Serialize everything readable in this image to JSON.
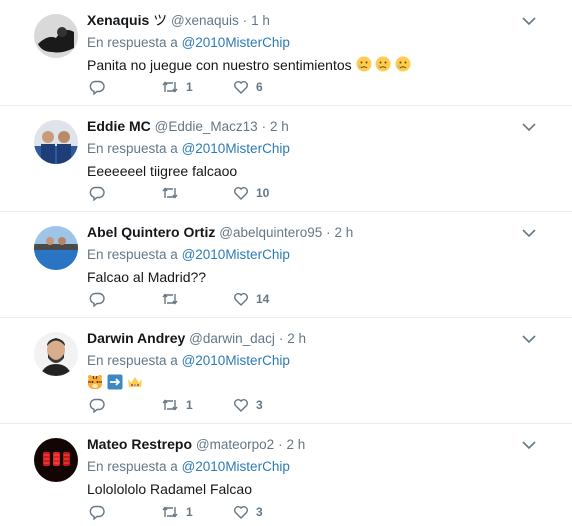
{
  "replies": [
    {
      "name": "Xenaquis",
      "name_suffix": "ツ",
      "handle": "@xenaquis",
      "time": "1 h",
      "reply_prefix": "En respuesta a",
      "reply_to": "@2010MisterChip",
      "text": "Panita no juegue con nuestro sentimientos",
      "emoji": [
        "crying-face",
        "crying-face",
        "crying-face"
      ],
      "reply_count": "",
      "retweet_count": "1",
      "like_count": "6"
    },
    {
      "name": "Eddie MC",
      "handle": "@Eddie_Macz13",
      "time": "2 h",
      "reply_prefix": "En respuesta a",
      "reply_to": "@2010MisterChip",
      "text": "Eeeeeeel tiigree falcaoo",
      "reply_count": "",
      "retweet_count": "",
      "like_count": "10"
    },
    {
      "name": "Abel Quintero Ortiz",
      "handle": "@abelquintero95",
      "time": "2 h",
      "reply_prefix": "En respuesta a",
      "reply_to": "@2010MisterChip",
      "text": "Falcao al Madrid??",
      "reply_count": "",
      "retweet_count": "",
      "like_count": "14"
    },
    {
      "name": "Darwin Andrey",
      "handle": "@darwin_dacj",
      "time": "2 h",
      "reply_prefix": "En respuesta a",
      "reply_to": "@2010MisterChip",
      "text": "",
      "emoji": [
        "tiger-face",
        "right-arrow",
        "crown"
      ],
      "reply_count": "",
      "retweet_count": "1",
      "like_count": "3"
    },
    {
      "name": "Mateo Restrepo",
      "handle": "@mateorpo2",
      "time": "2 h",
      "reply_prefix": "En respuesta a",
      "reply_to": "@2010MisterChip",
      "text": "Lololololo Radamel Falcao",
      "reply_count": "",
      "retweet_count": "1",
      "like_count": "3"
    }
  ],
  "colors": {
    "link": "#2b7bb9",
    "muted": "#657786",
    "divider": "#e6ecf0",
    "text": "#14171a"
  },
  "icons": {
    "reply": "reply-icon",
    "retweet": "retweet-icon",
    "like": "heart-icon",
    "more": "chevron-down-icon"
  }
}
